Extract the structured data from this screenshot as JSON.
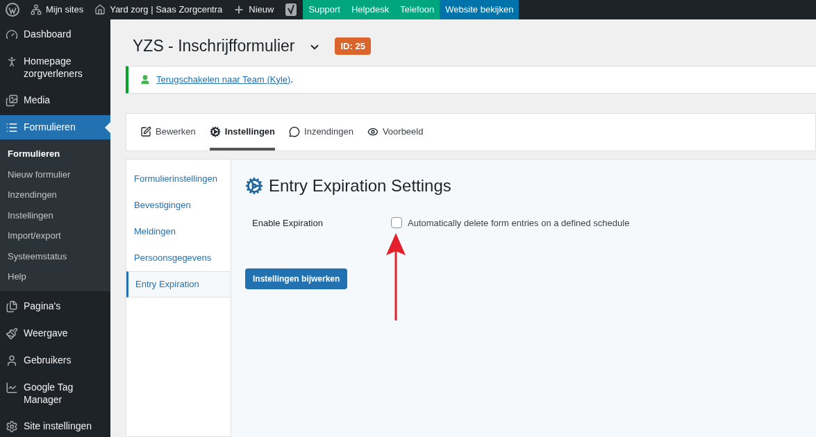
{
  "admin_bar": {
    "items": [
      {
        "kind": "wp"
      },
      {
        "kind": "sites",
        "label": "Mijn sites"
      },
      {
        "kind": "home",
        "label": "Yard zorg | Saas Zorgcentra"
      },
      {
        "kind": "new",
        "label": "Nieuw"
      },
      {
        "kind": "yoast"
      },
      {
        "kind": "link",
        "label": "Support",
        "color": "#00a67e"
      },
      {
        "kind": "link",
        "label": "Helpdesk",
        "color": "#00a67e"
      },
      {
        "kind": "link",
        "label": "Telefoon",
        "color": "#00a67e"
      },
      {
        "kind": "link",
        "label": "Website bekijken",
        "color": "#0073aa"
      }
    ]
  },
  "sidebar": {
    "items": [
      {
        "label": "Dashboard",
        "selected": false
      },
      {
        "label": "Homepage zorgverleners",
        "selected": false
      },
      {
        "label": "Media",
        "selected": false
      },
      {
        "label": "Formulieren",
        "selected": true,
        "children": [
          {
            "label": "Formulieren",
            "selected": true
          },
          {
            "label": "Nieuw formulier",
            "selected": false
          },
          {
            "label": "Inzendingen",
            "selected": false
          },
          {
            "label": "Instellingen",
            "selected": false
          },
          {
            "label": "Import/export",
            "selected": false
          },
          {
            "label": "Systeemstatus",
            "selected": false
          },
          {
            "label": "Help",
            "selected": false
          }
        ]
      },
      {
        "label": "Pagina's",
        "selected": false
      },
      {
        "label": "Weergave",
        "selected": false
      },
      {
        "label": "Gebruikers",
        "selected": false
      },
      {
        "label": "Google Tag Manager",
        "selected": false
      },
      {
        "label": "Site instellingen",
        "selected": false
      }
    ]
  },
  "header": {
    "title": "YZS - Inschrijfformulier",
    "badge": "ID: 25"
  },
  "notice": {
    "link": "Terugschakelen naar Team (Kyle)",
    "suffix": "."
  },
  "tabs": [
    {
      "label": "Bewerken",
      "selected": false
    },
    {
      "label": "Instellingen",
      "selected": true
    },
    {
      "label": "Inzendingen",
      "selected": false
    },
    {
      "label": "Voorbeeld",
      "selected": false
    }
  ],
  "settings_nav": [
    {
      "label": "Formulierinstellingen",
      "selected": false
    },
    {
      "label": "Bevestigingen",
      "selected": false
    },
    {
      "label": "Meldingen",
      "selected": false
    },
    {
      "label": "Persoonsgegevens",
      "selected": false
    },
    {
      "label": "Entry Expiration",
      "selected": true
    }
  ],
  "panel": {
    "title": "Entry Expiration Settings",
    "field_label": "Enable Expiration",
    "checkbox": {
      "label": "Automatically delete form entries on a defined schedule",
      "checked": false
    },
    "button": "Instellingen bijwerken"
  }
}
